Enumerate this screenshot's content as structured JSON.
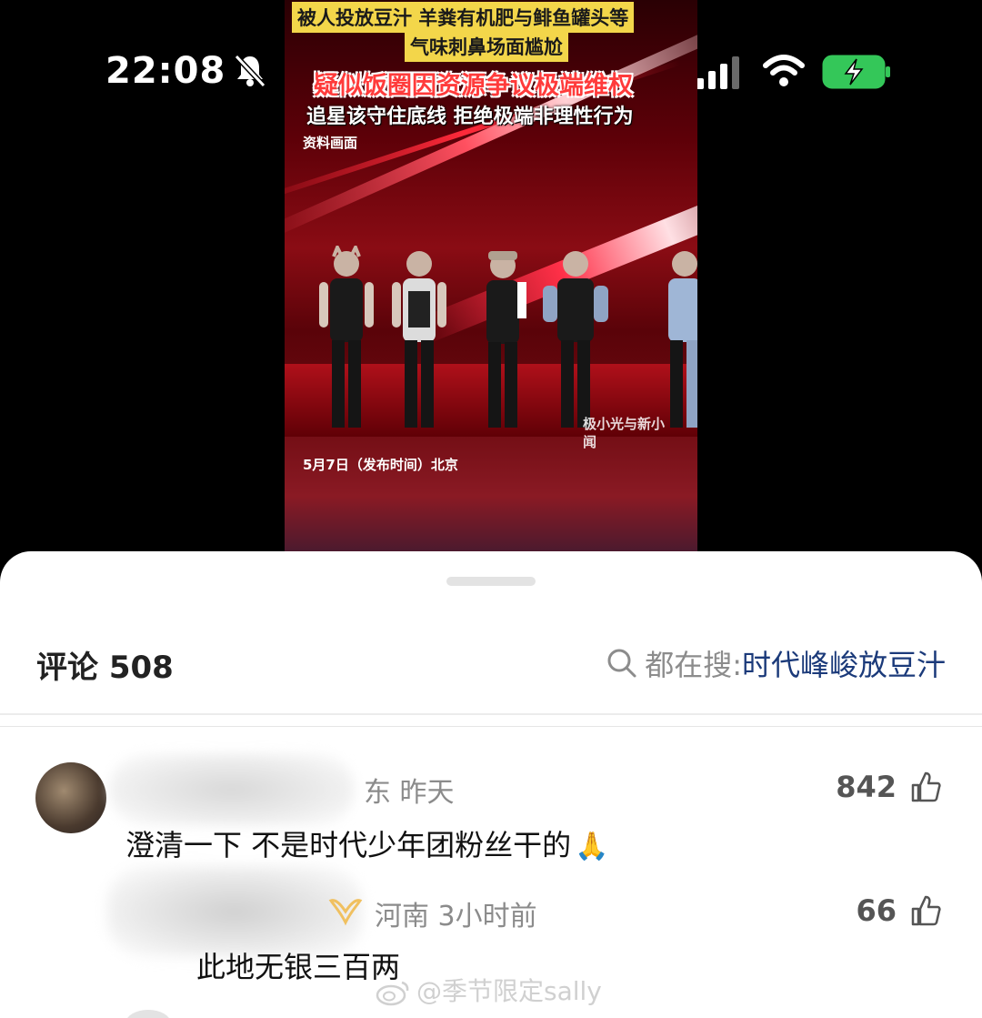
{
  "status_bar": {
    "time": "22:08"
  },
  "video": {
    "caption_line1": "被人投放豆汁 羊粪有机肥与鲱鱼罐头等",
    "caption_line2": "气味刺鼻场面尴尬",
    "caption_headline": "疑似饭圈因资源争议极端维权",
    "caption_sub": "追星该守住底线 拒绝极端非理性行为",
    "label_archive": "资料画面",
    "label_date": "5月7日（发布时间）北京",
    "watermark": "极小光与新小闻"
  },
  "comments_panel": {
    "title": "评论 508",
    "search_prefix": "都在搜:",
    "search_term": "时代峰峻放豆汁",
    "items": [
      {
        "meta": "东 昨天",
        "likes": "842",
        "text": "澄清一下 不是时代少年团粉丝干的",
        "emoji": "🙏"
      },
      {
        "meta": "河南 3小时前",
        "likes": "66",
        "text": "此地无银三百两"
      }
    ]
  },
  "watermark": "@季节限定sally",
  "colors": {
    "accent_link": "#1b3a7a",
    "meta_gray": "#8b8b8b",
    "battery_green": "#34c759"
  }
}
